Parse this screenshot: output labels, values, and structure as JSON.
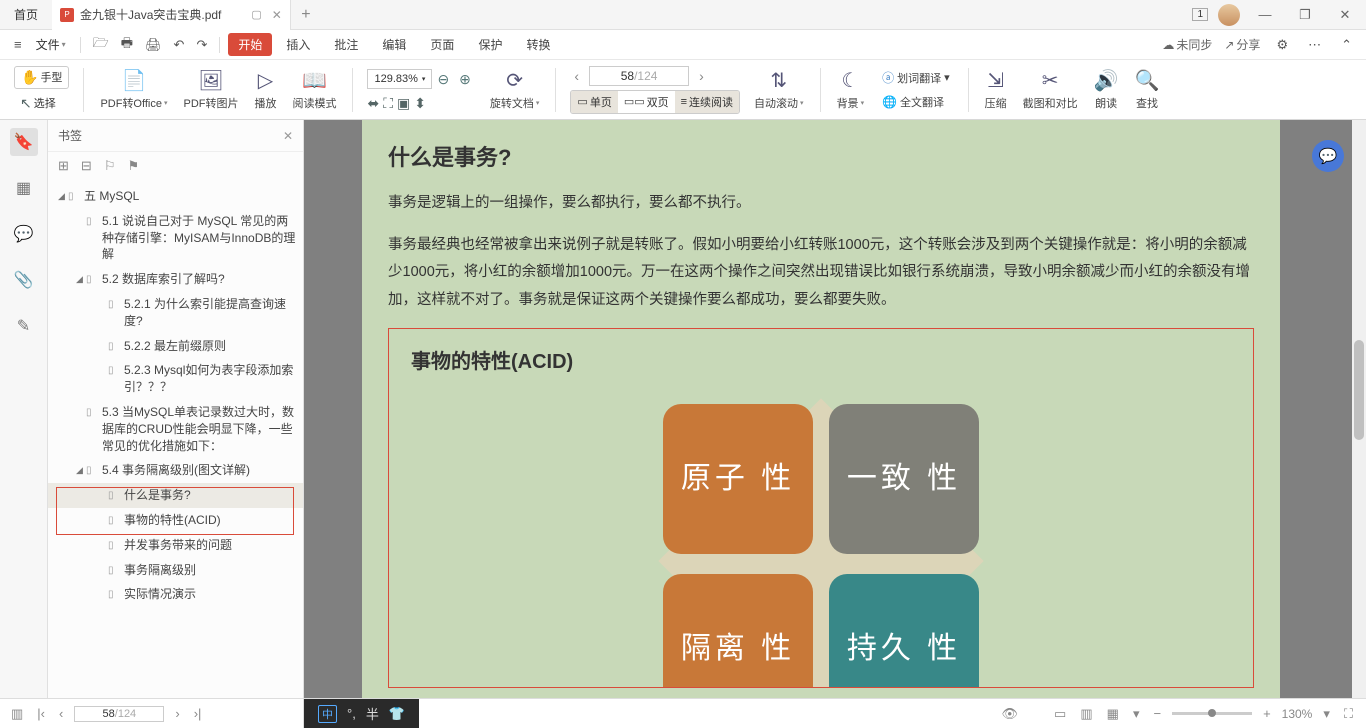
{
  "titlebar": {
    "home": "首页",
    "doc_name": "金九银十Java突击宝典.pdf",
    "restore": "▢",
    "window_count": "1"
  },
  "menubar": {
    "file": "文件",
    "start": "开始",
    "items": [
      "插入",
      "批注",
      "编辑",
      "页面",
      "保护",
      "转换"
    ],
    "unsync": "未同步",
    "share": "分享"
  },
  "ribbon": {
    "hand": "手型",
    "select": "选择",
    "pdf_to_office": "PDF转Office",
    "pdf_to_img": "PDF转图片",
    "play": "播放",
    "read_mode": "阅读模式",
    "zoom": "129.83%",
    "rotate": "旋转文档",
    "page_cur": "58",
    "page_total": "/124",
    "single": "单页",
    "double": "双页",
    "continuous": "连续阅读",
    "auto_scroll": "自动滚动",
    "background": "背景",
    "word_trans": "划词翻译",
    "full_trans": "全文翻译",
    "compress": "压缩",
    "crop_compare": "截图和对比",
    "read_aloud": "朗读",
    "find": "查找"
  },
  "bookmarks": {
    "title": "书签",
    "items": [
      {
        "level": 0,
        "twist": "◢",
        "label": "五 MySQL"
      },
      {
        "level": 1,
        "twist": "",
        "label": "5.1 说说自己对于 MySQL 常见的两种存储引擎：MyISAM与InnoDB的理解"
      },
      {
        "level": 1,
        "twist": "◢",
        "label": "5.2 数据库索引了解吗?"
      },
      {
        "level": 2,
        "twist": "",
        "label": "5.2.1 为什么索引能提高查询速度?"
      },
      {
        "level": 2,
        "twist": "",
        "label": "5.2.2 最左前缀原则"
      },
      {
        "level": 2,
        "twist": "",
        "label": "5.2.3 Mysql如何为表字段添加索引？？？"
      },
      {
        "level": 1,
        "twist": "",
        "label": "5.3 当MySQL单表记录数过大时，数据库的CRUD性能会明显下降，一些常见的优化措施如下："
      },
      {
        "level": 1,
        "twist": "◢",
        "label": "5.4 事务隔离级别(图文详解)"
      },
      {
        "level": 2,
        "twist": "",
        "label": "什么是事务?",
        "sel": true
      },
      {
        "level": 2,
        "twist": "",
        "label": "事物的特性(ACID)"
      },
      {
        "level": 2,
        "twist": "",
        "label": "并发事务带来的问题"
      },
      {
        "level": 2,
        "twist": "",
        "label": "事务隔离级别"
      },
      {
        "level": 2,
        "twist": "",
        "label": "实际情况演示"
      }
    ]
  },
  "document": {
    "h1": "什么是事务?",
    "p1": "事务是逻辑上的一组操作，要么都执行，要么都不执行。",
    "p2": "事务最经典也经常被拿出来说例子就是转账了。假如小明要给小红转账1000元，这个转账会涉及到两个关键操作就是：将小明的余额减少1000元，将小红的余额增加1000元。万一在这两个操作之间突然出现错误比如银行系统崩溃，导致小明余额减少而小红的余额没有增加，这样就不对了。事务就是保证这两个关键操作要么都成功，要么都要失败。",
    "acid_title": "事物的特性(ACID)",
    "acid": {
      "c1": "原子\n性",
      "c2": "一致\n性",
      "c3": "隔离\n性",
      "c4": "持久\n性"
    }
  },
  "ime": {
    "mode": "中",
    "punct": "°,",
    "width": "半",
    "shirt": "👕"
  },
  "status": {
    "page_cur": "58",
    "page_total": "/124",
    "zoom": "130%"
  }
}
